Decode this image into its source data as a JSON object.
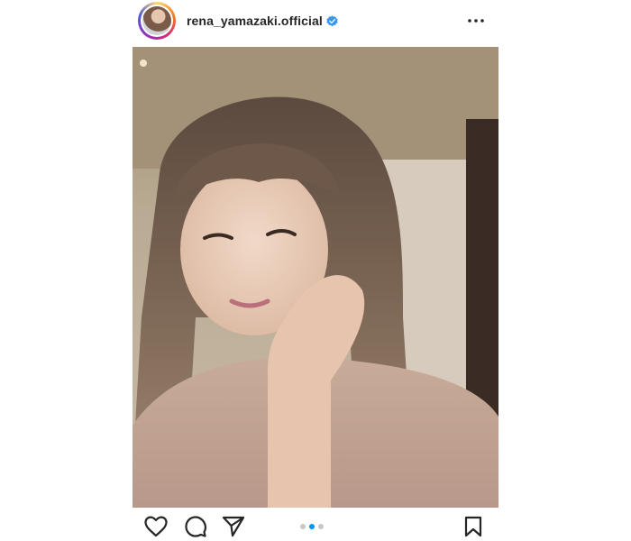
{
  "post": {
    "username": "rena_yamazaki.official",
    "verified": true,
    "icons": {
      "verified": "verified-badge-icon",
      "more": "more-options-icon",
      "like": "heart-icon",
      "comment": "comment-icon",
      "share": "share-icon",
      "save": "bookmark-icon"
    },
    "carousel": {
      "count": 3,
      "active_index": 1
    },
    "colors": {
      "verified": "#3897f0",
      "active_dot": "#0095f6",
      "inactive_dot": "#c8c8c8",
      "text": "#262626"
    }
  }
}
